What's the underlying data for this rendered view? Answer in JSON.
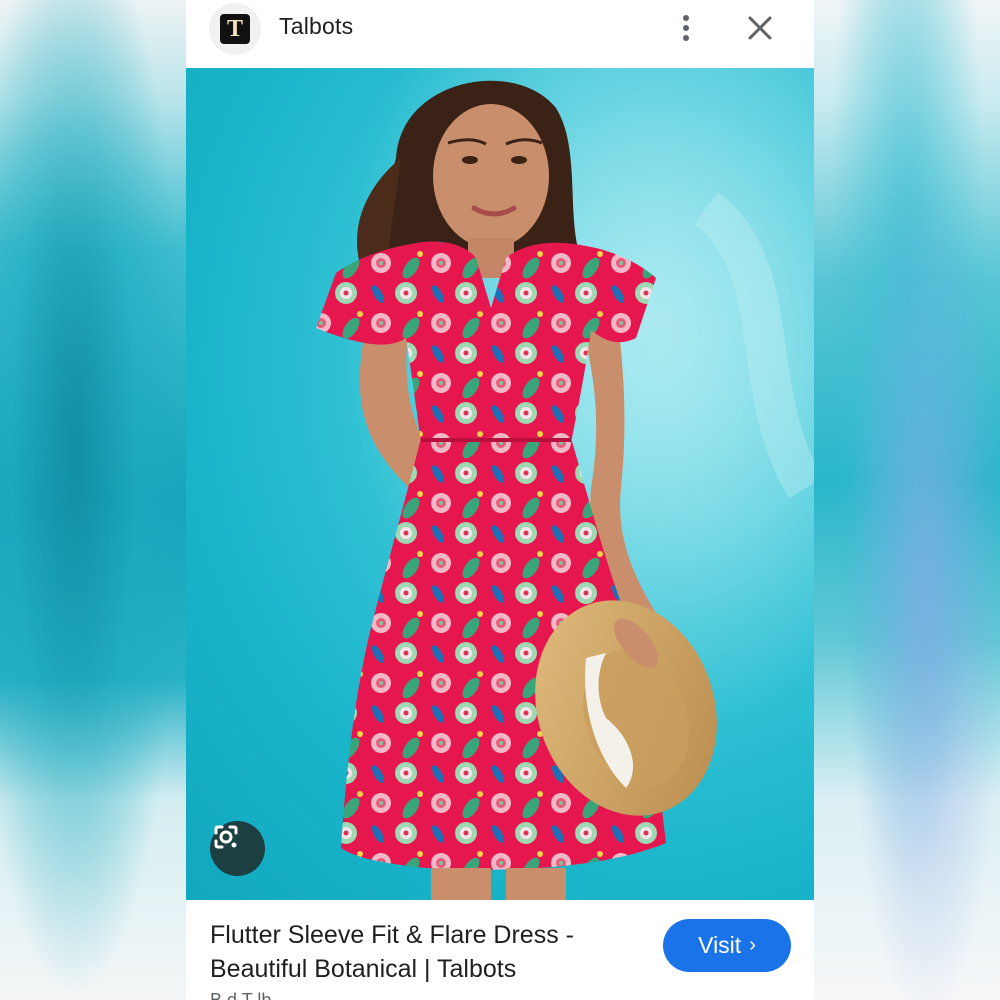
{
  "header": {
    "logo_letter": "T",
    "site_name": "Talbots",
    "more_icon": "more-vert-icon",
    "close_icon": "close-icon"
  },
  "image": {
    "description_icon": "lens-search-icon"
  },
  "result": {
    "title_line1": "Flutter Sleeve Fit & Flare Dress -",
    "title_line2": "Beautiful Botanical | Talbots",
    "source_partial": "B        d   T  lb",
    "visit_label": "Visit",
    "visit_icon": "chevron-right-icon"
  },
  "colors": {
    "visit_button": "#1a73e8",
    "background_teal": "#19b4ca",
    "dress_pink": "#e8184f"
  }
}
